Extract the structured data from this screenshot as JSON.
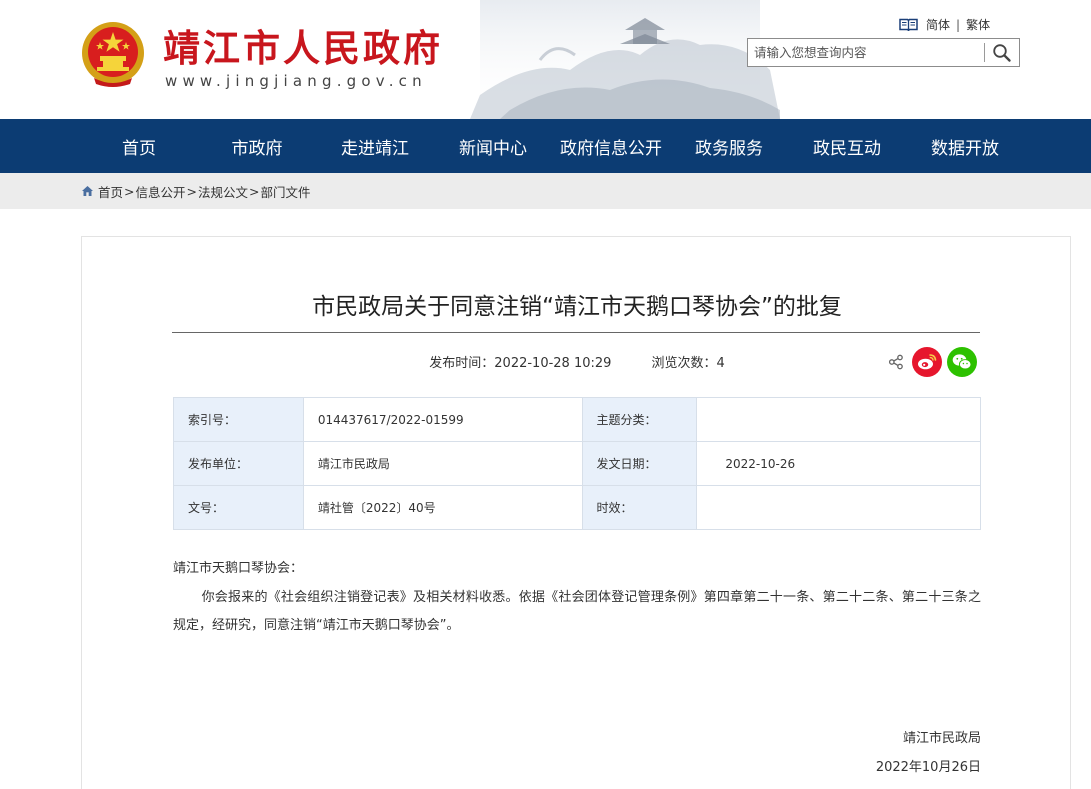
{
  "header": {
    "site_title": "靖江市人民政府",
    "site_url": "www.jingjiang.gov.cn",
    "lang": {
      "simplified": "简体",
      "separator": "|",
      "traditional": "繁体"
    },
    "search": {
      "placeholder": "请输入您想查询内容",
      "value": ""
    }
  },
  "nav": {
    "items": [
      "首页",
      "市政府",
      "走进靖江",
      "新闻中心",
      "政府信息公开",
      "政务服务",
      "政民互动",
      "数据开放"
    ]
  },
  "breadcrumb": {
    "items": [
      "首页",
      "信息公开",
      "法规公文",
      "部门文件"
    ],
    "separator": ">"
  },
  "article": {
    "title": "市民政局关于同意注销“靖江市天鹅口琴协会”的批复",
    "publish_label": "发布时间：",
    "publish_time": "2022-10-28 10:29",
    "views_label": "浏览次数：",
    "views": "4",
    "info": {
      "index_label": "索引号：",
      "index_value": "014437617/2022-01599",
      "topic_label": "主题分类：",
      "topic_value": "",
      "publisher_label": "发布单位：",
      "publisher_value": "靖江市民政局",
      "date_label": "发文日期：",
      "date_value": "2022-10-26",
      "docno_label": "文号：",
      "docno_value": "靖社管〔2022〕40号",
      "validity_label": "时效：",
      "validity_value": ""
    },
    "salutation": "靖江市天鹅口琴协会：",
    "body": "你会报来的《社会组织注销登记表》及相关材料收悉。依据《社会团体登记管理条例》第四章第二十一条、第二十二条、第二十三条之规定，经研究，同意注销“靖江市天鹅口琴协会”。",
    "signature": "靖江市民政局",
    "sign_date": "2022年10月26日"
  },
  "colors": {
    "brand_red": "#c8161d",
    "nav_blue": "#0c3c73",
    "weibo_red": "#e6162d",
    "wechat_green": "#2dc100",
    "table_key_bg": "#e8f0fa"
  },
  "icons": [
    "emblem-icon",
    "book-icon",
    "search-icon",
    "home-icon",
    "share-icon",
    "weibo-icon",
    "wechat-icon"
  ]
}
